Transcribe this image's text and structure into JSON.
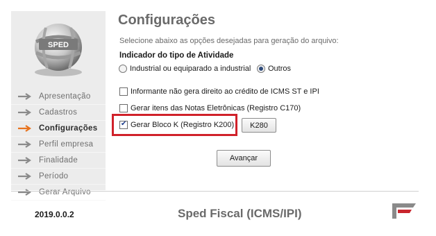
{
  "logo": {
    "text": "SPED"
  },
  "sidebar": {
    "items": [
      {
        "label": "Apresentação",
        "active": false
      },
      {
        "label": "Cadastros",
        "active": false
      },
      {
        "label": "Configurações",
        "active": true
      },
      {
        "label": "Perfil empresa",
        "active": false
      },
      {
        "label": "Finalidade",
        "active": false
      },
      {
        "label": "Período",
        "active": false
      },
      {
        "label": "Gerar Arquivo",
        "active": false
      }
    ],
    "arrow_color": "#8a8a8a",
    "active_arrow_color": "#e8731e"
  },
  "main": {
    "title": "Configurações",
    "subtitle": "Selecione abaixo as opções desejadas para geração do arquivo:",
    "activity_label": "Indicador do tipo de Atividade",
    "radio_industrial": "Industrial ou equiparado a industrial",
    "radio_outros": "Outros",
    "radio_selected": "Outros",
    "check_icms": {
      "label": "Informante não gera direito ao crédito de ICMS ST e IPI",
      "checked": false
    },
    "check_c170": {
      "label": "Gerar itens das Notas Eletrônicas (Registro C170)",
      "checked": false
    },
    "check_blocok": {
      "label": "Gerar Bloco K (Registro K200)",
      "checked": true
    },
    "k280_button": "K280",
    "next_button": "Avançar",
    "highlight_color": "#d0212a"
  },
  "footer": {
    "version": "2019.0.0.2",
    "product": "Sped Fiscal (ICMS/IPI)"
  }
}
